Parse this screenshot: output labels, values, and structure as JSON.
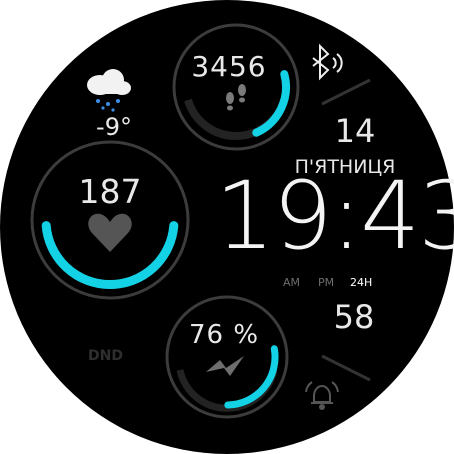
{
  "colors": {
    "background": "#000000",
    "accent": "#14d2e6",
    "ring": "#3c3c3c",
    "text": "#e8e8e8",
    "muted": "#6e6e6e"
  },
  "weather": {
    "icon": "rain-cloud-icon",
    "temperature": "-9°"
  },
  "steps": {
    "icon": "footsteps-icon",
    "value": "3456",
    "progress": 0.45
  },
  "heart_rate": {
    "icon": "heart-icon",
    "value": "187",
    "progress": 0.5
  },
  "battery": {
    "icon": "lightning-icon",
    "value": "76 %",
    "progress": 0.55
  },
  "status": {
    "bluetooth_icon": "bluetooth-icon",
    "dnd_label": "DND",
    "dnd_icon": "moon-icon",
    "alarm_icon": "alarm-icon"
  },
  "date": {
    "day": "14",
    "weekday": "П'ЯТНИЦЯ",
    "seconds": "58"
  },
  "time": {
    "hours": "19",
    "separator": ":",
    "minutes": "43",
    "am_label": "AM",
    "pm_label": "PM",
    "h24_label": "24H"
  }
}
